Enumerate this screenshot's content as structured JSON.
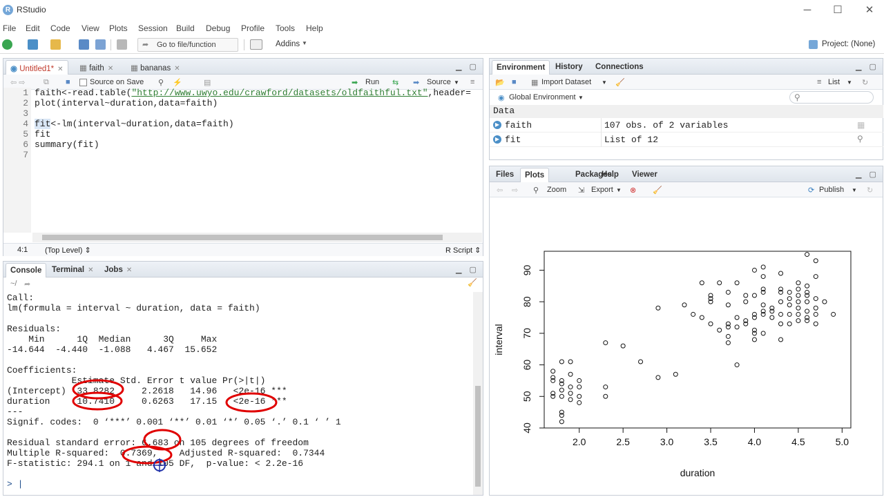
{
  "app": {
    "title": "RStudio",
    "logo_letter": "R"
  },
  "window_controls": {
    "minimize": "─",
    "maximize": "☐",
    "close": "✕"
  },
  "menu": [
    "File",
    "Edit",
    "Code",
    "View",
    "Plots",
    "Session",
    "Build",
    "Debug",
    "Profile",
    "Tools",
    "Help"
  ],
  "toolbar": {
    "goto_placeholder": "Go to file/function",
    "addins": "Addins",
    "project": "Project: (None)"
  },
  "editor": {
    "tabs": [
      {
        "label": "Untitled1*"
      },
      {
        "label": "faith"
      },
      {
        "label": "bananas"
      }
    ],
    "source_on_save": "Source on Save",
    "run_label": "Run",
    "source_label": "Source",
    "lines": [
      {
        "num": "1",
        "pre": "faith<-read.table(",
        "str": "\"http://www.uwyo.edu/crawford/datasets/oldfaithful.txt\"",
        "post": ",header="
      },
      {
        "num": "2",
        "pre": "plot(interval~duration,data=faith)",
        "str": "",
        "post": ""
      },
      {
        "num": "3",
        "pre": "",
        "str": "",
        "post": ""
      },
      {
        "num": "4",
        "pre": "fit",
        "str": "",
        "post": "<-lm(interval~duration,data=faith)"
      },
      {
        "num": "5",
        "pre": "fit",
        "str": "",
        "post": ""
      },
      {
        "num": "6",
        "pre": "summary(fit)",
        "str": "",
        "post": ""
      },
      {
        "num": "7",
        "pre": "",
        "str": "",
        "post": ""
      }
    ],
    "status_pos": "4:1",
    "status_level": "(Top Level) ⇕",
    "status_type": "R Script ⇕"
  },
  "console": {
    "tabs": [
      {
        "label": "Console"
      },
      {
        "label": "Terminal"
      },
      {
        "label": "Jobs"
      }
    ],
    "path": "~/",
    "lines": [
      "Call:",
      "lm(formula = interval ~ duration, data = faith)",
      "",
      "Residuals:",
      "    Min      1Q  Median      3Q     Max ",
      "-14.644  -4.440  -1.088   4.467  15.652 ",
      "",
      "Coefficients:",
      "            Estimate Std. Error t value Pr(>|t|)    ",
      "(Intercept)  33.8282     2.2618   14.96   <2e-16 ***",
      "duration     10.7410     0.6263   17.15   <2e-16 ***",
      "---",
      "Signif. codes:  0 ‘***’ 0.001 ‘**’ 0.01 ‘*’ 0.05 ‘.’ 0.1 ‘ ’ 1",
      "",
      "Residual standard error: 6.683 on 105 degrees of freedom",
      "Multiple R-squared:  0.7369,\tAdjusted R-squared:  0.7344 ",
      "F-statistic: 294.1 on 1 and 105 DF,  p-value: < 2.2e-16",
      ""
    ],
    "prompt": "> |"
  },
  "environment": {
    "tabs": [
      {
        "label": "Environment"
      },
      {
        "label": "History"
      },
      {
        "label": "Connections"
      }
    ],
    "import_dataset": "Import Dataset",
    "list_view": "List",
    "scope": "Global Environment",
    "section": "Data",
    "rows": [
      {
        "name": "faith",
        "value": "107 obs. of 2 variables"
      },
      {
        "name": "fit",
        "value": "List of 12"
      }
    ]
  },
  "plots_pane": {
    "tabs": [
      {
        "label": "Files"
      },
      {
        "label": "Plots"
      },
      {
        "label": "Packages"
      },
      {
        "label": "Help"
      },
      {
        "label": "Viewer"
      }
    ],
    "zoom": "Zoom",
    "export": "Export",
    "publish": "Publish"
  },
  "chart_data": {
    "type": "scatter",
    "xlabel": "duration",
    "ylabel": "interval",
    "xlim": [
      1.6,
      5.1
    ],
    "ylim": [
      40,
      96
    ],
    "xticks": [
      "2.0",
      "2.5",
      "3.0",
      "3.5",
      "4.0",
      "4.5",
      "5.0"
    ],
    "yticks": [
      "40",
      "50",
      "60",
      "70",
      "80",
      "90"
    ],
    "points": [
      [
        1.7,
        58
      ],
      [
        1.7,
        56
      ],
      [
        1.7,
        55
      ],
      [
        1.7,
        51
      ],
      [
        1.7,
        50
      ],
      [
        1.8,
        61
      ],
      [
        1.8,
        55
      ],
      [
        1.8,
        54
      ],
      [
        1.8,
        52
      ],
      [
        1.8,
        50
      ],
      [
        1.8,
        45
      ],
      [
        1.8,
        44
      ],
      [
        1.8,
        42
      ],
      [
        1.9,
        61
      ],
      [
        1.9,
        57
      ],
      [
        1.9,
        53
      ],
      [
        1.9,
        51
      ],
      [
        1.9,
        49
      ],
      [
        2.0,
        55
      ],
      [
        2.0,
        53
      ],
      [
        2.0,
        50
      ],
      [
        2.0,
        48
      ],
      [
        2.3,
        67
      ],
      [
        2.3,
        53
      ],
      [
        2.3,
        50
      ],
      [
        2.5,
        66
      ],
      [
        2.7,
        61
      ],
      [
        2.9,
        78
      ],
      [
        2.9,
        56
      ],
      [
        3.1,
        57
      ],
      [
        3.2,
        79
      ],
      [
        3.3,
        76
      ],
      [
        3.4,
        86
      ],
      [
        3.4,
        75
      ],
      [
        3.5,
        82
      ],
      [
        3.5,
        81
      ],
      [
        3.5,
        80
      ],
      [
        3.5,
        73
      ],
      [
        3.6,
        86
      ],
      [
        3.6,
        71
      ],
      [
        3.7,
        83
      ],
      [
        3.7,
        79
      ],
      [
        3.7,
        73
      ],
      [
        3.7,
        72
      ],
      [
        3.7,
        69
      ],
      [
        3.7,
        67
      ],
      [
        3.8,
        86
      ],
      [
        3.8,
        75
      ],
      [
        3.8,
        72
      ],
      [
        3.8,
        60
      ],
      [
        3.9,
        82
      ],
      [
        3.9,
        80
      ],
      [
        3.9,
        74
      ],
      [
        3.9,
        73
      ],
      [
        4.0,
        90
      ],
      [
        4.0,
        82
      ],
      [
        4.0,
        76
      ],
      [
        4.0,
        75
      ],
      [
        4.0,
        71
      ],
      [
        4.0,
        70
      ],
      [
        4.0,
        68
      ],
      [
        4.1,
        91
      ],
      [
        4.1,
        88
      ],
      [
        4.1,
        84
      ],
      [
        4.1,
        83
      ],
      [
        4.1,
        79
      ],
      [
        4.1,
        77
      ],
      [
        4.1,
        76
      ],
      [
        4.1,
        70
      ],
      [
        4.2,
        78
      ],
      [
        4.2,
        77
      ],
      [
        4.2,
        75
      ],
      [
        4.3,
        89
      ],
      [
        4.3,
        84
      ],
      [
        4.3,
        83
      ],
      [
        4.3,
        80
      ],
      [
        4.3,
        76
      ],
      [
        4.3,
        73
      ],
      [
        4.3,
        68
      ],
      [
        4.4,
        83
      ],
      [
        4.4,
        81
      ],
      [
        4.4,
        79
      ],
      [
        4.4,
        76
      ],
      [
        4.4,
        73
      ],
      [
        4.5,
        86
      ],
      [
        4.5,
        84
      ],
      [
        4.5,
        82
      ],
      [
        4.5,
        78
      ],
      [
        4.5,
        76
      ],
      [
        4.5,
        74
      ],
      [
        4.6,
        95
      ],
      [
        4.6,
        85
      ],
      [
        4.6,
        83
      ],
      [
        4.6,
        82
      ],
      [
        4.6,
        80
      ],
      [
        4.6,
        77
      ],
      [
        4.6,
        75
      ],
      [
        4.6,
        74
      ],
      [
        4.7,
        93
      ],
      [
        4.7,
        88
      ],
      [
        4.7,
        81
      ],
      [
        4.7,
        78
      ],
      [
        4.7,
        76
      ],
      [
        4.7,
        73
      ],
      [
        4.8,
        80
      ],
      [
        4.9,
        76
      ],
      [
        4.5,
        80
      ]
    ]
  }
}
